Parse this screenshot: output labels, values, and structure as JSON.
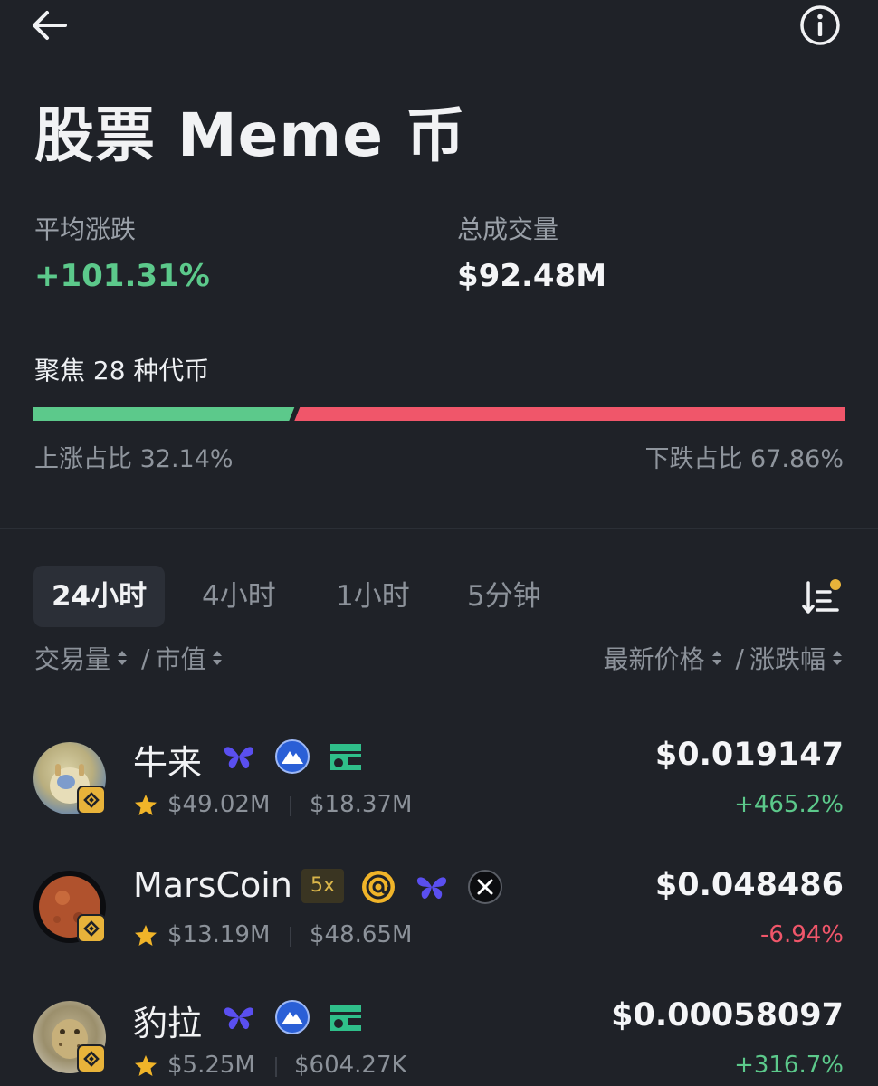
{
  "header": {
    "back_icon": "arrow-left-icon",
    "info_icon": "info-circle-icon",
    "title": "股票 Meme 币"
  },
  "stats": {
    "avg_change_label": "平均涨跌",
    "avg_change_value": "+101.31%",
    "volume_label": "总成交量",
    "volume_value": "$92.48M"
  },
  "focus": {
    "label": "聚焦 28 种代币",
    "up_ratio_fraction": 0.3214,
    "up_label": "上涨占比 32.14%",
    "down_label": "下跌占比 67.86%"
  },
  "colors": {
    "up": "#5cc98b",
    "down": "#f0566a",
    "background": "#1f2228"
  },
  "tabs": [
    {
      "label": "24小时",
      "active": true
    },
    {
      "label": "4小时",
      "active": false
    },
    {
      "label": "1小时",
      "active": false
    },
    {
      "label": "5分钟",
      "active": false
    }
  ],
  "columns": {
    "volume": "交易量",
    "slash1": "/",
    "market_cap": "市值",
    "price": "最新价格",
    "slash2": "/",
    "change": "涨跌幅"
  },
  "coins": [
    {
      "name": "牛来",
      "volume": "$49.02M",
      "market_cap": "$18.37M",
      "price": "$0.019147",
      "change": "+465.2%",
      "direction": "up",
      "icons": [
        "butterfly-icon",
        "mountain-badge-icon",
        "wallet-icon"
      ]
    },
    {
      "name": "MarsCoin",
      "leverage": "5x",
      "volume": "$13.19M",
      "market_cap": "$48.65M",
      "price": "$0.048486",
      "change": "-6.94%",
      "direction": "down",
      "icons": [
        "at-sign-icon",
        "butterfly-icon",
        "x-logo-icon"
      ]
    },
    {
      "name": "豹拉",
      "volume": "$5.25M",
      "market_cap": "$604.27K",
      "price": "$0.00058097",
      "change": "+316.7%",
      "direction": "up",
      "icons": [
        "butterfly-icon",
        "mountain-badge-icon",
        "wallet-icon"
      ]
    }
  ]
}
